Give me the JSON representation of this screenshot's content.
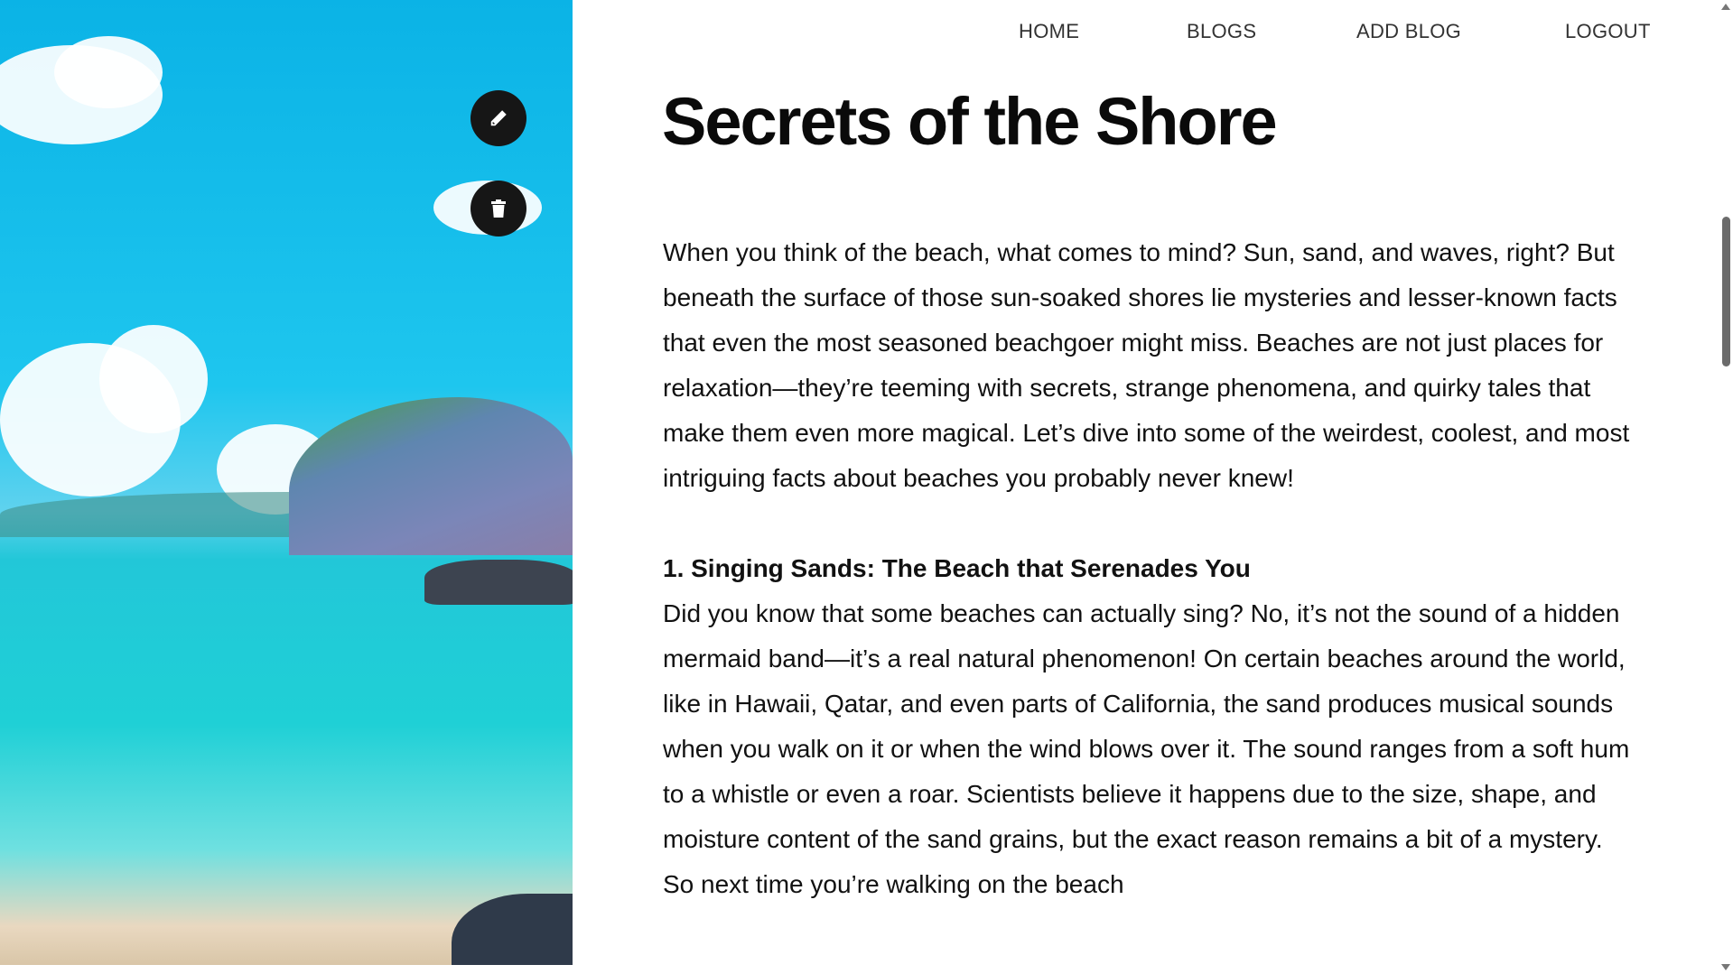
{
  "nav": {
    "items": [
      "HOME",
      "BLOGS",
      "ADD BLOG",
      "LOGOUT"
    ]
  },
  "actions": {
    "edit_icon": "pencil-icon",
    "delete_icon": "trash-icon"
  },
  "post": {
    "title": "Secrets of the Shore",
    "intro": "When you think of the beach, what comes to mind? Sun, sand, and waves, right? But beneath the surface of those sun-soaked shores lie mysteries and lesser-known facts that even the most seasoned beachgoer might miss. Beaches are not just places for relaxation—they’re teeming with secrets, strange phenomena, and quirky tales that make them even more magical. Let’s dive into some of the weirdest, coolest, and most intriguing facts about beaches you probably never knew!",
    "section1_heading": "1. Singing Sands: The Beach that Serenades You",
    "section1_body": "Did you know that some beaches can actually sing? No, it’s not the sound of a hidden mermaid band—it’s a real natural phenomenon! On certain beaches around the world, like in Hawaii, Qatar, and even parts of California, the sand produces musical sounds when you walk on it or when the wind blows over it. The sound ranges from a soft hum to a whistle or even a roar. Scientists believe it happens due to the size, shape, and moisture content of the sand grains, but the exact reason remains a bit of a mystery. So next time you’re walking on the beach"
  }
}
